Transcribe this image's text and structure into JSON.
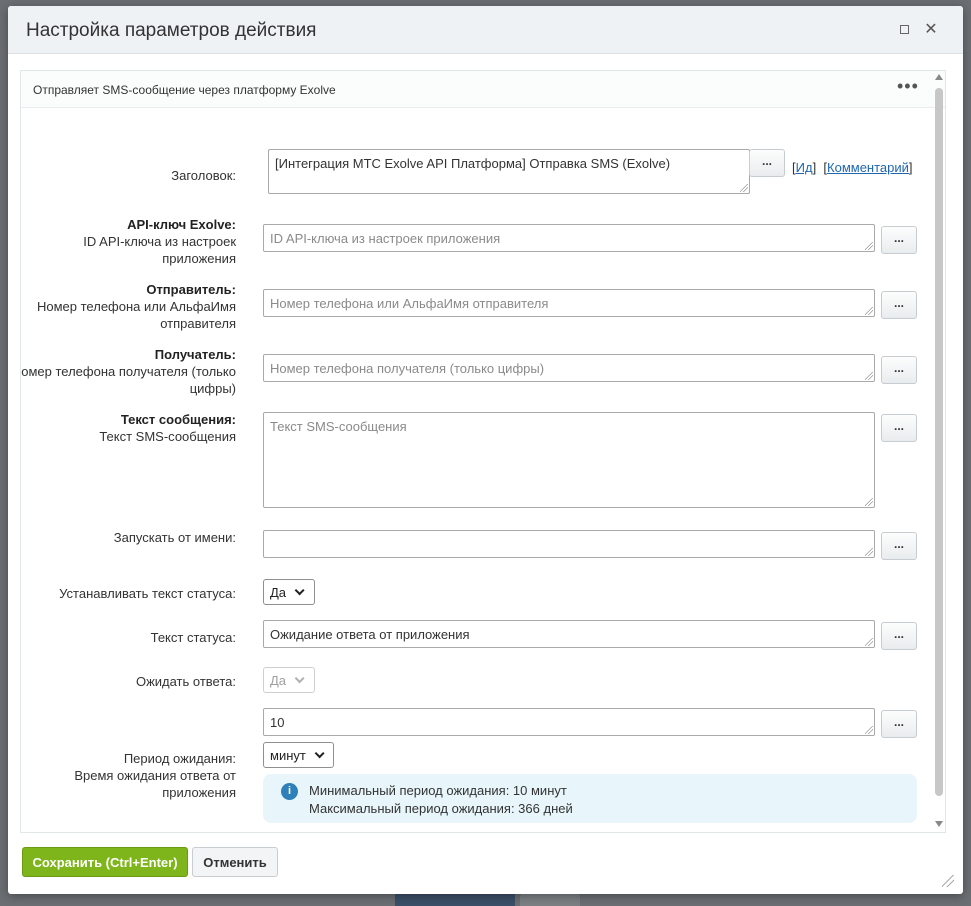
{
  "dialog": {
    "title": "Настройка параметров действия",
    "maximize_icon": "maximize-icon",
    "close_icon": "close-icon"
  },
  "panel": {
    "description": "Отправляет SMS-сообщение через платформу Exolve",
    "more": "•••"
  },
  "fields": {
    "title": {
      "label": "Заголовок:",
      "value": "[Интеграция МТС Exolve API Платформа] Отправка SMS (Exolve)"
    },
    "links": {
      "id": "Ид",
      "comment": "Комментарий"
    },
    "api_key": {
      "label": "API-ключ Exolve:",
      "hint": "ID API-ключа из настроек приложения",
      "placeholder": "ID API-ключа из настроек приложения"
    },
    "sender": {
      "label": "Отправитель:",
      "hint": "Номер телефона или АльфаИмя отправителя",
      "placeholder": "Номер телефона или АльфаИмя отправителя"
    },
    "recipient": {
      "label": "Получатель:",
      "hint": "Номер телефона получателя (только цифры)",
      "placeholder": "Номер телефона получателя (только цифры)"
    },
    "message": {
      "label": "Текст сообщения:",
      "hint": "Текст SMS-сообщения",
      "placeholder": "Текст SMS-сообщения"
    },
    "run_as": {
      "label": "Запускать от имени:",
      "value": ""
    },
    "set_status": {
      "label": "Устанавливать текст статуса:",
      "value": "Да"
    },
    "status_text": {
      "label": "Текст статуса:",
      "value": "Ожидание ответа от приложения"
    },
    "wait_response": {
      "label": "Ожидать ответа:",
      "value": "Да"
    },
    "wait_period": {
      "label": "Период ожидания:",
      "hint": "Время ожидания ответа от приложения",
      "value": "10",
      "unit": "минут"
    },
    "info": {
      "min": "Минимальный период ожидания: 10 минут",
      "max": "Максимальный период ожидания: 366 дней"
    },
    "dots_label": "..."
  },
  "footer": {
    "save": "Сохранить (Ctrl+Enter)",
    "cancel": "Отменить"
  }
}
